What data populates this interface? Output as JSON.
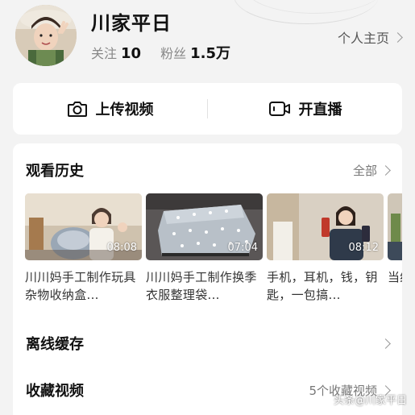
{
  "profile": {
    "username": "川家平日",
    "following_label": "关注",
    "following_count": "10",
    "followers_label": "粉丝",
    "followers_count": "1.5万",
    "homepage_label": "个人主页"
  },
  "actions": {
    "upload_label": "上传视频",
    "live_label": "开直播"
  },
  "history": {
    "title": "观看历史",
    "all_label": "全部",
    "videos": [
      {
        "title": "川川妈手工制作玩具杂物收纳盒...",
        "duration": "08:08"
      },
      {
        "title": "川川妈手工制作换季衣服整理袋...",
        "duration": "07:04"
      },
      {
        "title": "手机，耳机，钱，钥匙，一包搞...",
        "duration": "08:12"
      },
      {
        "title": "当结",
        "duration": ""
      }
    ]
  },
  "offline": {
    "title": "离线缓存"
  },
  "favorites": {
    "title": "收藏视频",
    "count_label": "5个收藏视频"
  },
  "watermark": "头条@川家平日",
  "colors": {
    "background": "#f3f3f3",
    "card": "#ffffff",
    "muted_text": "#777777"
  },
  "icons": [
    "camera-icon",
    "video-camera-icon",
    "chevron-right-icon"
  ]
}
